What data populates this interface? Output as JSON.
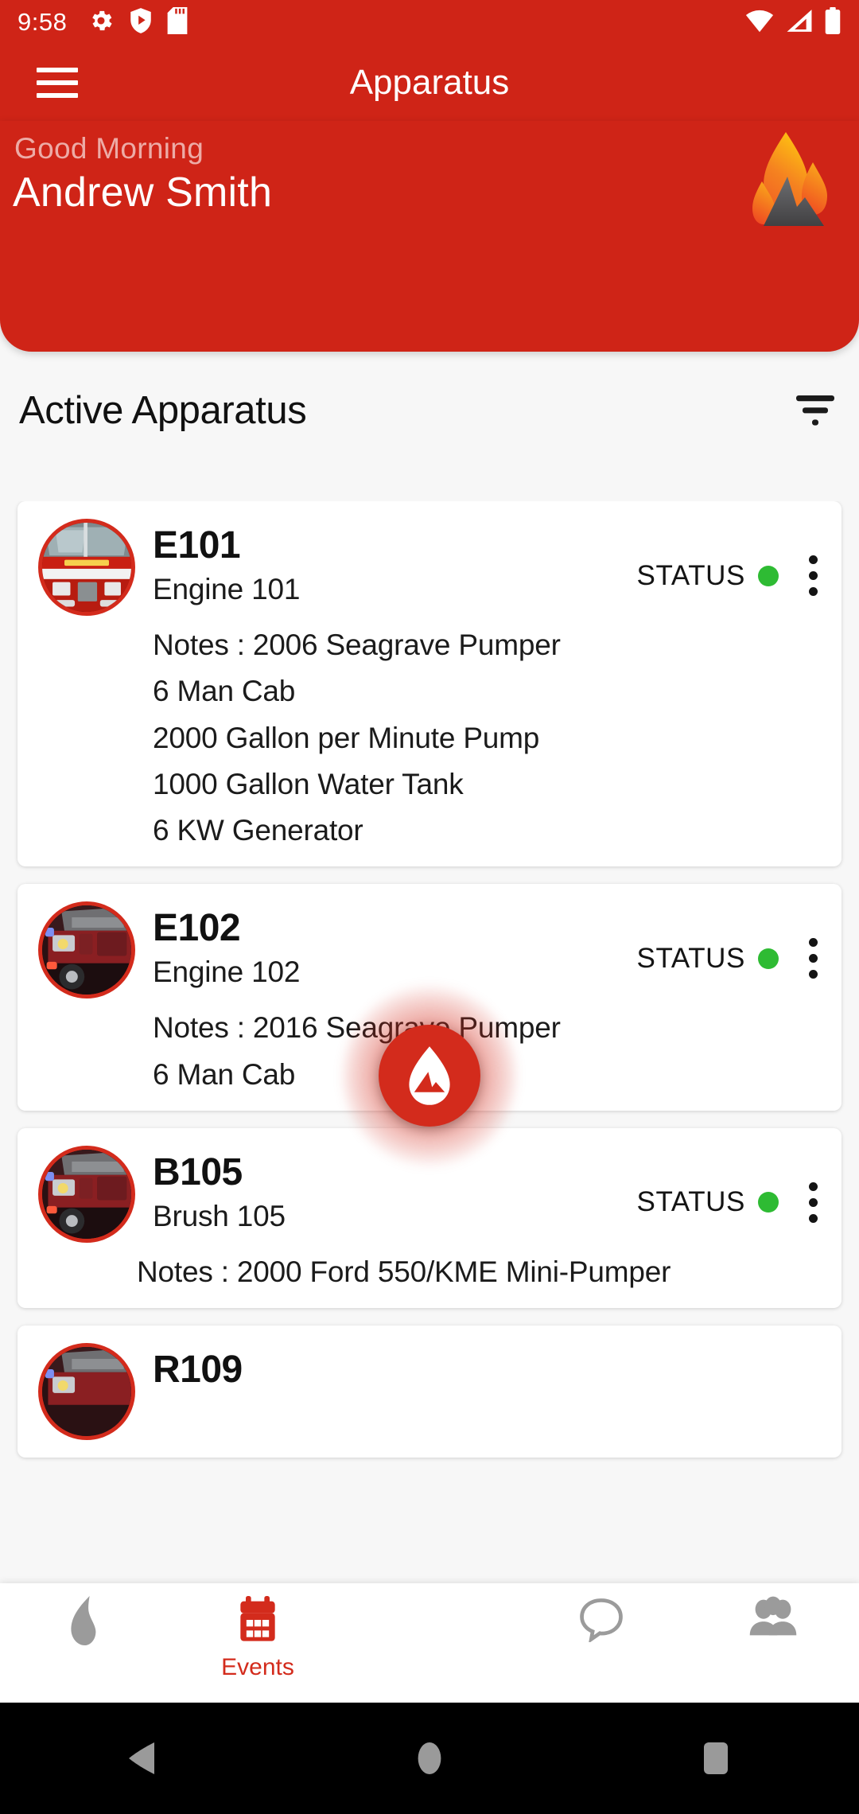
{
  "status_bar": {
    "time": "9:58",
    "left_icons": [
      "gear-icon",
      "play-protect-icon",
      "sd-card-icon"
    ],
    "right_icons": [
      "wifi-icon",
      "cellular-signal-icon",
      "battery-icon"
    ]
  },
  "app_bar": {
    "menu_icon": "hamburger-menu-icon",
    "title": "Apparatus"
  },
  "greeting": {
    "salutation": "Good Morning",
    "user_name": "Andrew Smith",
    "logo": "flame-logo"
  },
  "section": {
    "title": "Active Apparatus",
    "filter_icon": "filter-icon"
  },
  "apparatus_list": [
    {
      "code": "E101",
      "name": "Engine 101",
      "status_label": "STATUS",
      "status_color": "#2ebb33",
      "notes": [
        "Notes : 2006 Seagrave Pumper",
        "6 Man Cab",
        "2000 Gallon per Minute Pump",
        "1000 Gallon Water Tank",
        "6 KW Generator"
      ]
    },
    {
      "code": "E102",
      "name": "Engine 102",
      "status_label": "STATUS",
      "status_color": "#2ebb33",
      "notes": [
        "Notes : 2016 Seagrave Pumper",
        "6 Man Cab"
      ]
    },
    {
      "code": "B105",
      "name": "Brush 105",
      "status_label": "STATUS",
      "status_color": "#2ebb33",
      "notes": [
        "Notes : 2000 Ford 550/KME Mini-Pumper"
      ]
    },
    {
      "code": "R109",
      "name": "",
      "status_label": "",
      "status_color": "#2ebb33",
      "notes": []
    }
  ],
  "fab": {
    "icon": "flame-icon"
  },
  "bottom_nav": [
    {
      "icon": "flame-icon",
      "label": "",
      "active": false
    },
    {
      "icon": "calendar-icon",
      "label": "Events",
      "active": true
    },
    {
      "icon": "chat-bubble-icon",
      "label": "",
      "active": false
    },
    {
      "icon": "people-group-icon",
      "label": "",
      "active": false
    }
  ],
  "android_nav": {
    "back": "back-triangle-icon",
    "home": "home-circle-icon",
    "recents": "recents-square-icon"
  },
  "colors": {
    "brand_red": "#cf2417",
    "accent_red": "#d32b1c",
    "status_green": "#2ebb33",
    "page_bg": "#f7f7f7"
  }
}
